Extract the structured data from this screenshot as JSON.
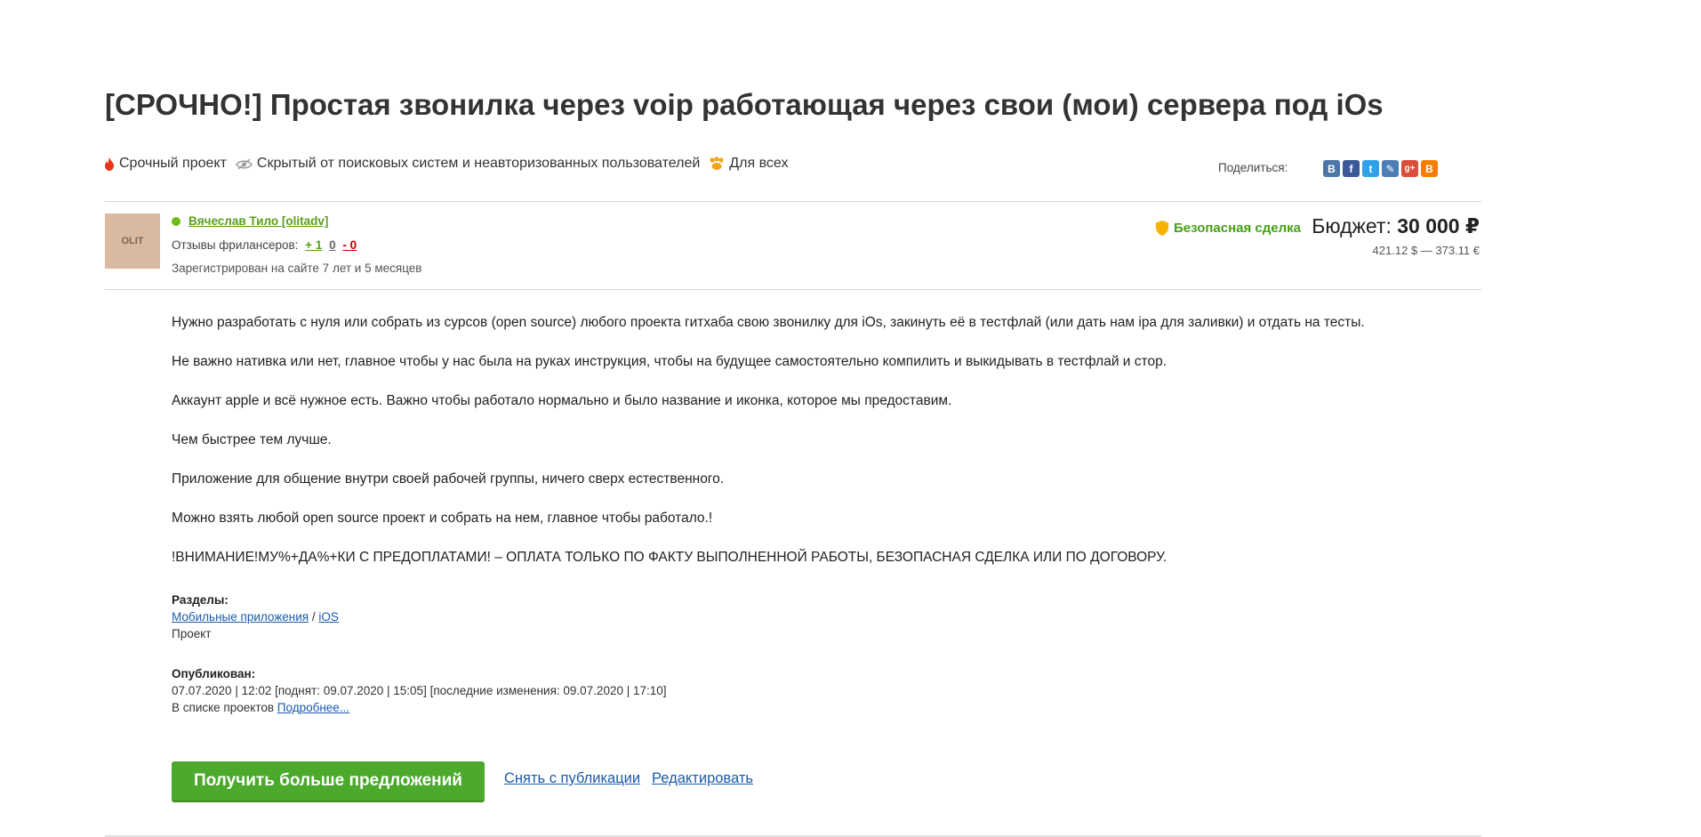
{
  "project": {
    "title": "[СРОЧНО!] Простая звонилка через voip работающая через свои (мои) сервера под iOs",
    "tags": [
      {
        "icon": "fire-icon",
        "label": "Срочный проект"
      },
      {
        "icon": "hidden-eye-icon",
        "label": "Скрытый от поисковых систем и неавторизованных пользователей"
      },
      {
        "icon": "paw-icon",
        "label": "Для всех"
      }
    ]
  },
  "share": {
    "label": "Поделиться:",
    "icons": [
      {
        "name": "vk-share-icon",
        "glyph": "В",
        "color": "#4a76a8"
      },
      {
        "name": "facebook-share-icon",
        "glyph": "f",
        "color": "#3b5998"
      },
      {
        "name": "twitter-share-icon",
        "glyph": "t",
        "color": "#2ea1e8"
      },
      {
        "name": "livejournal-share-icon",
        "glyph": "✎",
        "color": "#4c7db5"
      },
      {
        "name": "google-plus-share-icon",
        "glyph": "g+",
        "color": "#dd4b39"
      },
      {
        "name": "blogger-share-icon",
        "glyph": "B",
        "color": "#f57d00"
      }
    ]
  },
  "author": {
    "avatar_text": "OLIT",
    "name": "Вячеслав Тило [olitadv]",
    "reviews_label": "Отзывы фрилансеров:",
    "reviews_positive": "+ 1",
    "reviews_neutral": "0",
    "reviews_negative": "- 0",
    "registered": "Зарегистрирован на сайте 7 лет и 5 месяцев"
  },
  "deal": {
    "safe_label": "Безопасная сделка",
    "budget_label": "Бюджет:",
    "budget_value": "30 000 ₽",
    "budget_conversion": "421.12 $ — 373.11 €"
  },
  "description": [
    "Нужно разработать с нуля или собрать из сурсов (open source) любого проекта гитхаба свою звонилку для iOs, закинуть её в тестфлай (или дать нам ipa для заливки) и отдать на тесты.",
    "Не важно нативка или нет, главное чтобы у нас была на руках инструкция, чтобы на будущее самостоятельно компилить и выкидывать в тестфлай и стор.",
    "Аккаунт apple и всё нужное есть. Важно чтобы работало нормально и было название и иконка, которое мы предоставим.",
    "Чем быстрее тем лучше.",
    "Приложение для общение внутри своей рабочей группы, ничего сверх естественного.",
    "Можно взять любой open source проект и собрать на нем, главное чтобы работало.!",
    "!ВНИМАНИЕ!МУ%+ДА%+КИ С ПРЕДОПЛАТАМИ! – ОПЛАТА ТОЛЬКО ПО ФАКТУ ВЫПОЛНЕННОЙ РАБОТЫ, БЕЗОПАСНАЯ СДЕЛКА ИЛИ ПО ДОГОВОРУ."
  ],
  "sections": {
    "label": "Разделы:",
    "category": "Мобильные приложения",
    "separator": "/",
    "subcategory": "iOS",
    "type": "Проект"
  },
  "published": {
    "label": "Опубликован:",
    "dates": "07.07.2020 | 12:02 [поднят: 09.07.2020 | 15:05] [последние изменения: 09.07.2020 | 17:10]",
    "in_list_label": "В списке проектов",
    "in_list_link": "Подробнее..."
  },
  "actions": {
    "more_offers": "Получить больше предложений",
    "unpublish": "Снять с публикации",
    "edit": "Редактировать"
  }
}
